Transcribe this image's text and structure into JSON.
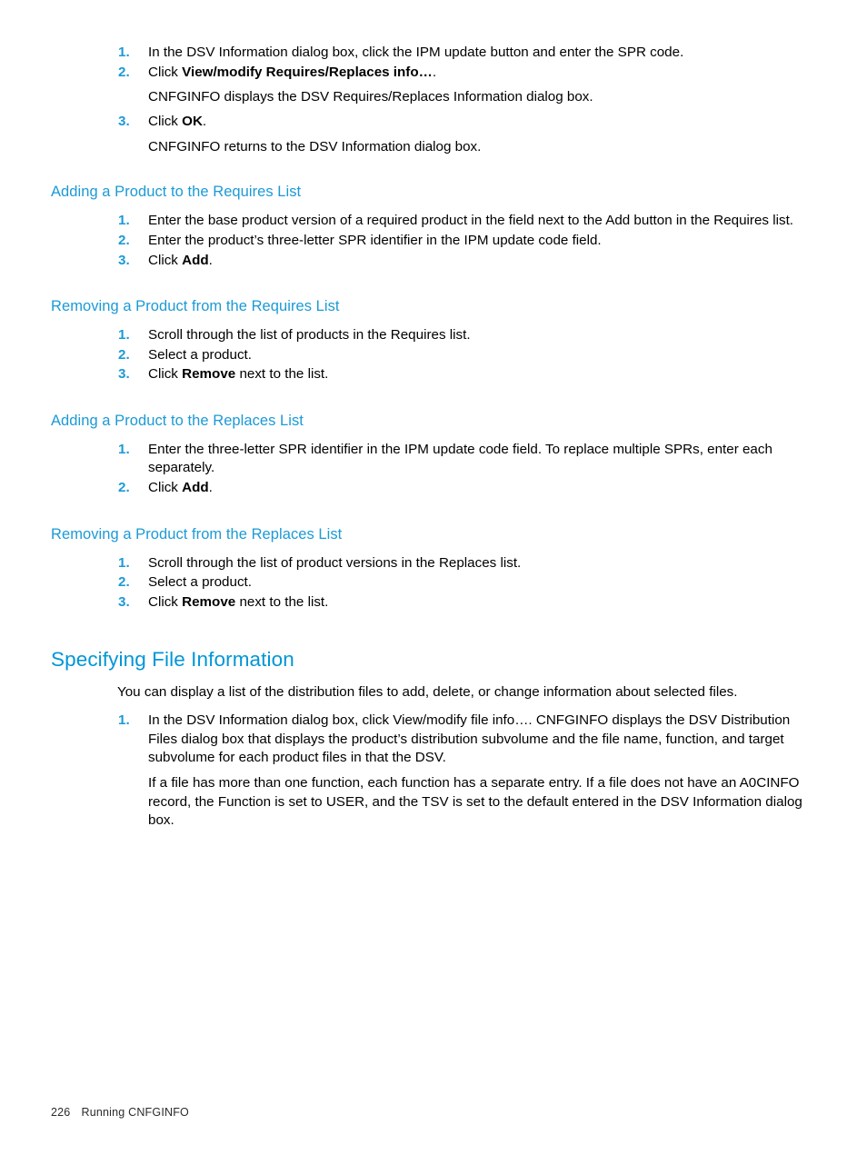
{
  "page": {
    "footer_page_number": "226",
    "footer_title": "Running CNFGINFO",
    "heading_color": "#0096d6",
    "body_color": "#000000"
  },
  "top_steps": {
    "items": [
      {
        "num": "1.",
        "text": "In the DSV Information dialog box, click the IPM update button and enter the SPR code."
      },
      {
        "num": "2.",
        "text_before": "Click ",
        "bold": "View/modify Requires/Replaces info…",
        "text_after": ".",
        "follow_up": "CNFGINFO displays the DSV Requires/Replaces Information dialog box."
      },
      {
        "num": "3.",
        "text_before": "Click ",
        "bold": "OK",
        "text_after": ".",
        "follow_up": "CNFGINFO returns to the DSV Information dialog box."
      }
    ]
  },
  "sections": [
    {
      "heading": "Adding a Product to the Requires List",
      "steps": [
        {
          "num": "1.",
          "text": "Enter the base product version of a required product in the field next to the Add button in the Requires list."
        },
        {
          "num": "2.",
          "text": "Enter the product’s three-letter SPR identifier in the IPM update code field."
        },
        {
          "num": "3.",
          "text_before": "Click ",
          "bold": "Add",
          "text_after": "."
        }
      ]
    },
    {
      "heading": "Removing a Product from the Requires List",
      "steps": [
        {
          "num": "1.",
          "text": "Scroll through the list of products in the Requires list."
        },
        {
          "num": "2.",
          "text": "Select a product."
        },
        {
          "num": "3.",
          "text_before": "Click ",
          "bold": "Remove",
          "text_after": " next to the list."
        }
      ]
    },
    {
      "heading": "Adding a Product to the Replaces List",
      "steps": [
        {
          "num": "1.",
          "text": "Enter the three-letter SPR identifier in the IPM update code field. To replace multiple SPRs, enter each separately."
        },
        {
          "num": "2.",
          "text_before": "Click ",
          "bold": "Add",
          "text_after": "."
        }
      ]
    },
    {
      "heading": "Removing a Product from the Replaces List",
      "steps": [
        {
          "num": "1.",
          "text": "Scroll through the list of product versions in the Replaces list."
        },
        {
          "num": "2.",
          "text": "Select a product."
        },
        {
          "num": "3.",
          "text_before": "Click ",
          "bold": "Remove",
          "text_after": " next to the list."
        }
      ]
    }
  ],
  "main_section": {
    "heading": "Specifying File Information",
    "intro": "You can display a list of the distribution files to add, delete, or change information about selected files.",
    "steps": [
      {
        "num": "1.",
        "text": "In the DSV Information dialog box, click View/modify file info…. CNFGINFO displays the DSV Distribution Files dialog box that displays the product’s distribution subvolume and the file name, function, and target subvolume for each product files in that the DSV.",
        "follow_up": "If a file has more than one function, each function has a separate entry. If a file does not have an A0CINFO record, the Function is set to USER, and the TSV is set to the default entered in the DSV Information dialog box."
      }
    ]
  }
}
